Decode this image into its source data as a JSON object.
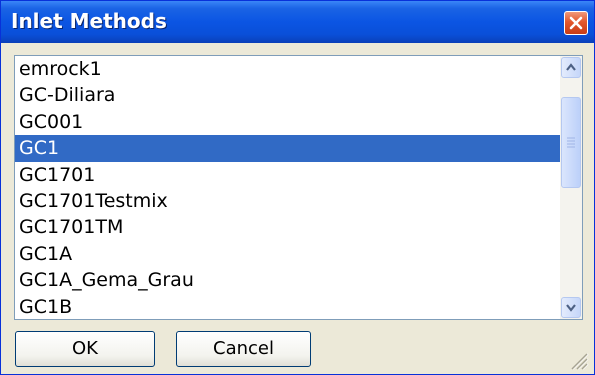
{
  "window": {
    "title": "Inlet Methods",
    "close_icon": "close-icon"
  },
  "methods_list": {
    "items": [
      {
        "label": "emrock1",
        "selected": false
      },
      {
        "label": "GC-Diliara",
        "selected": false
      },
      {
        "label": "GC001",
        "selected": false
      },
      {
        "label": "GC1",
        "selected": true
      },
      {
        "label": "GC1701",
        "selected": false
      },
      {
        "label": "GC1701Testmix",
        "selected": false
      },
      {
        "label": "GC1701TM",
        "selected": false
      },
      {
        "label": "GC1A",
        "selected": false
      },
      {
        "label": "GC1A_Gema_Grau",
        "selected": false
      },
      {
        "label": "GC1B",
        "selected": false
      }
    ],
    "scrollbar": {
      "up_icon": "scroll-up-arrow-icon",
      "down_icon": "scroll-down-arrow-icon",
      "grip_icon": "scrollbar-thumb-grip-icon"
    }
  },
  "buttons": {
    "ok_label": "OK",
    "cancel_label": "Cancel"
  },
  "resize_grip_icon": "resize-grip-icon",
  "colors": {
    "titlebar": "#0b55e3",
    "selection": "#316ac5",
    "dialog_background": "#ece9d8",
    "close_button": "#e3572d"
  }
}
